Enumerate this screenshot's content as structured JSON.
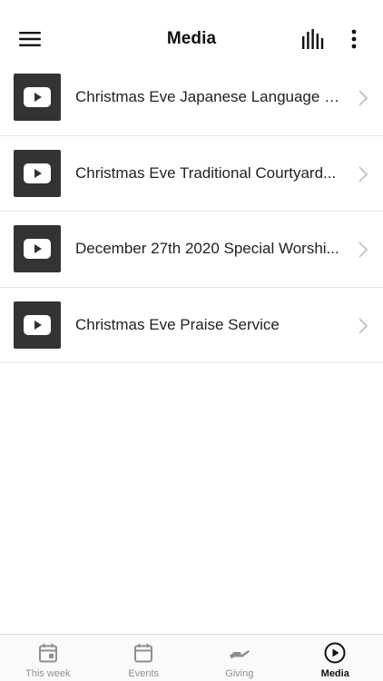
{
  "header": {
    "title": "Media",
    "menu_icon": "hamburger-menu-icon",
    "audio_icon": "audio-bars-icon",
    "more_icon": "vertical-dots-icon"
  },
  "media_items": [
    {
      "title": "Christmas Eve Japanese Language S...",
      "icon": "youtube-play-icon"
    },
    {
      "title": "Christmas Eve Traditional Courtyard...",
      "icon": "youtube-play-icon"
    },
    {
      "title": "December 27th 2020 Special Worshi...",
      "icon": "youtube-play-icon"
    },
    {
      "title": "Christmas Eve Praise Service",
      "icon": "youtube-play-icon"
    }
  ],
  "tabs": [
    {
      "label": "This week",
      "icon": "calendar-day-icon",
      "active": false
    },
    {
      "label": "Events",
      "icon": "calendar-icon",
      "active": false
    },
    {
      "label": "Giving",
      "icon": "giving-hand-icon",
      "active": false
    },
    {
      "label": "Media",
      "icon": "play-circle-icon",
      "active": true
    }
  ],
  "colors": {
    "thumb_bg": "#333333",
    "active_tab": "#111111",
    "inactive_tab": "#8e8e93",
    "divider": "#e6e6e6"
  }
}
